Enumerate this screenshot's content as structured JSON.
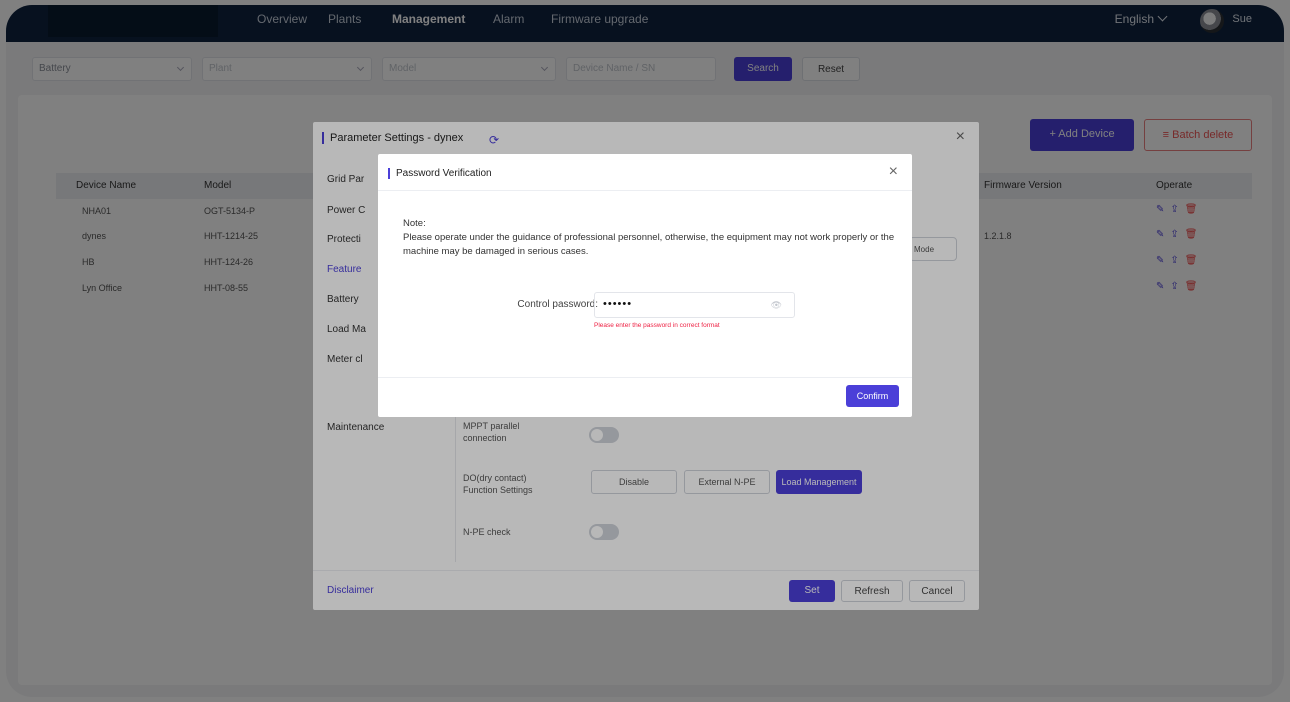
{
  "nav": {
    "items": [
      "Overview",
      "Plants",
      "Management",
      "Alarm",
      "Firmware upgrade"
    ],
    "active": "Management",
    "language": "English",
    "user": "Sue"
  },
  "filters": {
    "selects": [
      "Battery",
      "Plant",
      "Model",
      "Device Name / SN"
    ],
    "search_label": "Search",
    "reset_label": "Reset"
  },
  "panel": {
    "add_label": "+ Add Device",
    "batch_label": "≡ Batch delete",
    "columns": [
      "Device Name",
      "Model",
      "Firmware Version",
      "Operate"
    ],
    "rows": [
      {
        "name": "NHA01",
        "model": "OGT-5134-P",
        "firmware": ""
      },
      {
        "name": "dynes",
        "model": "HHT-1214-25",
        "firmware": "1.2.1.8"
      },
      {
        "name": "HB",
        "model": "HHT-124-26",
        "firmware": ""
      },
      {
        "name": "Lyn Office",
        "model": "HHT-08-55",
        "firmware": ""
      }
    ]
  },
  "param_dialog": {
    "title": "Parameter Settings - dynex",
    "nav": [
      "Grid Par",
      "Power C",
      "Protecti",
      "Feature",
      "Battery",
      "Load Ma",
      "Meter cl",
      "Maintenance"
    ],
    "nav_active": "Feature",
    "edge_btn": "Mode",
    "mppt_label": "MPPT parallel connection",
    "dry_label": "DO(dry contact) Function Settings",
    "dry_options": [
      "Disable",
      "External N-PE",
      "Load Management"
    ],
    "dry_selected": "Load Management",
    "npe_label": "N-PE check",
    "footer": {
      "link": "Disclaimer",
      "set": "Set",
      "refresh": "Refresh",
      "cancel": "Cancel"
    }
  },
  "verify_dialog": {
    "title": "Password Verification",
    "note_title": "Note:",
    "note_body": "Please operate under the guidance of professional personnel, otherwise, the equipment may not work properly or the machine may be damaged in serious cases.",
    "password_label": "Control password:",
    "password_value": "••••••",
    "error": "Please enter the password in correct format",
    "confirm": "Confirm"
  }
}
